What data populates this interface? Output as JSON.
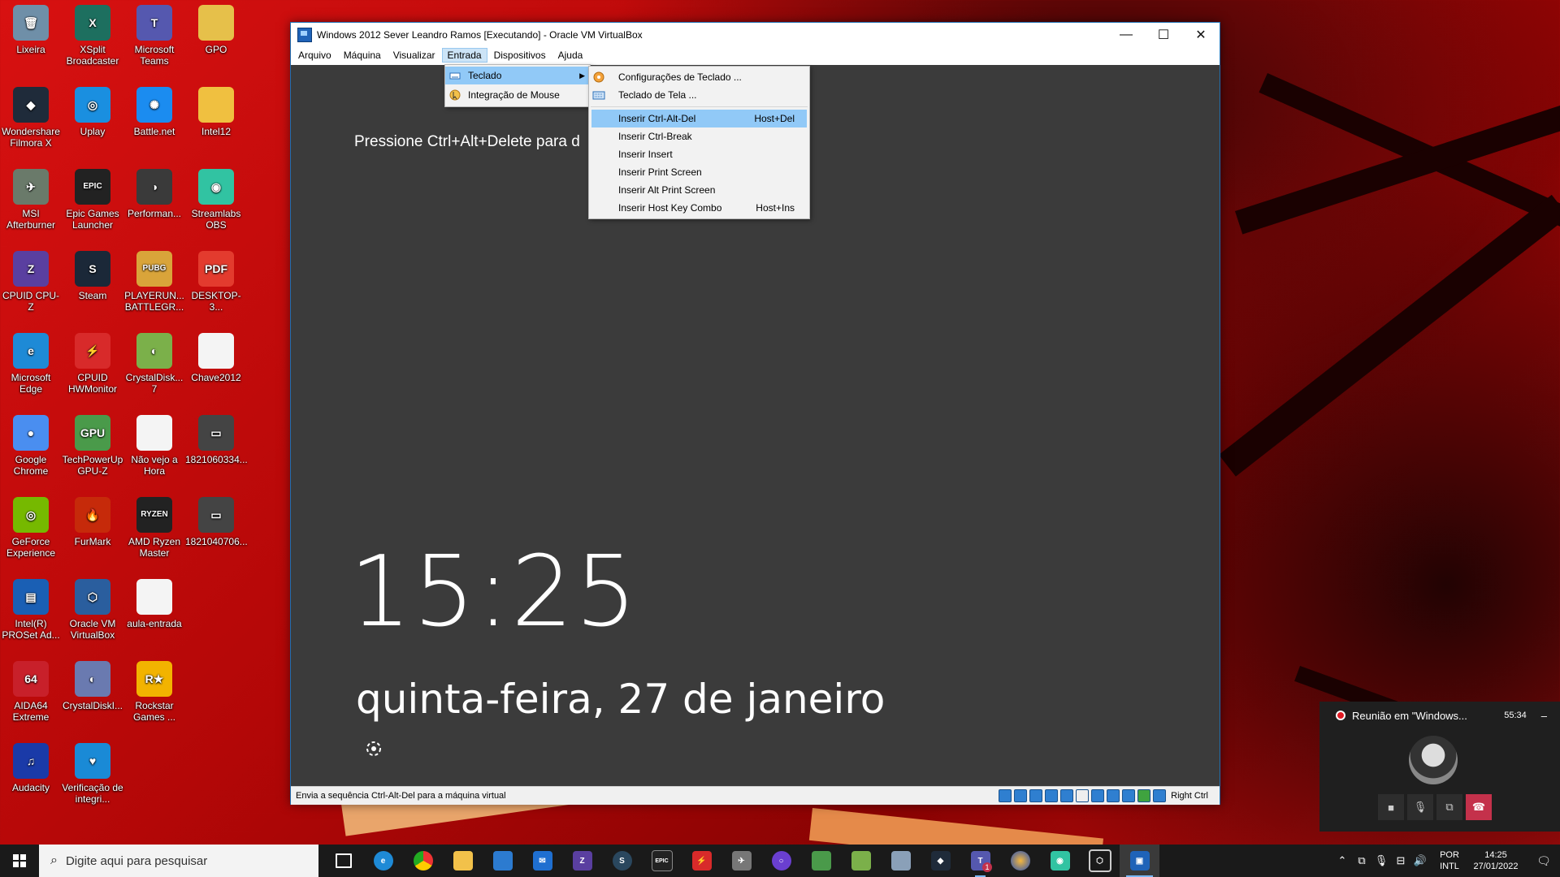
{
  "desktop": {
    "icons": [
      {
        "label": "Lixeira",
        "color": "#6f8fa8",
        "glyph": "🗑"
      },
      {
        "label": "XSplit Broadcaster",
        "color": "#1d6f5f",
        "glyph": "X"
      },
      {
        "label": "Microsoft Teams",
        "color": "#5558af",
        "glyph": "T"
      },
      {
        "label": "GPO",
        "color": "#e6c04a",
        "glyph": ""
      },
      {
        "label": "Wondershare Filmora X",
        "color": "#1f2b3a",
        "glyph": "◆"
      },
      {
        "label": "Uplay",
        "color": "#1a8fe0",
        "glyph": "◎"
      },
      {
        "label": "Battle.net",
        "color": "#1b8cf0",
        "glyph": "✺"
      },
      {
        "label": "Intel12",
        "color": "#f0c040",
        "glyph": ""
      },
      {
        "label": "MSI Afterburner",
        "color": "#6a7a6a",
        "glyph": "✈"
      },
      {
        "label": "Epic Games Launcher",
        "color": "#222222",
        "glyph": "EPIC"
      },
      {
        "label": "Performan...",
        "color": "#3a3a3a",
        "glyph": "◑"
      },
      {
        "label": "Streamlabs OBS",
        "color": "#31c3a2",
        "glyph": "◉"
      },
      {
        "label": "CPUID CPU-Z",
        "color": "#5a3fa0",
        "glyph": "Z"
      },
      {
        "label": "Steam",
        "color": "#1b2838",
        "glyph": "S"
      },
      {
        "label": "PLAYERUN... BATTLEGR...",
        "color": "#d9a43a",
        "glyph": "PUBG"
      },
      {
        "label": "DESKTOP-3...",
        "color": "#e33b2e",
        "glyph": "PDF"
      },
      {
        "label": "Microsoft Edge",
        "color": "#1e8ad6",
        "glyph": "e"
      },
      {
        "label": "CPUID HWMonitor",
        "color": "#d82a2a",
        "glyph": "⚡"
      },
      {
        "label": "CrystalDisk... 7",
        "color": "#7bb04a",
        "glyph": "◐"
      },
      {
        "label": "Chave2012",
        "color": "#f4f4f4",
        "glyph": ""
      },
      {
        "label": "Google Chrome",
        "color": "#4a8ef0",
        "glyph": "●"
      },
      {
        "label": "TechPowerUp GPU-Z",
        "color": "#4a9a4a",
        "glyph": "GPU"
      },
      {
        "label": "Não vejo a Hora",
        "color": "#f4f4f4",
        "glyph": ""
      },
      {
        "label": "1821060334...",
        "color": "#444444",
        "glyph": "▭"
      },
      {
        "label": "GeForce Experience",
        "color": "#76b900",
        "glyph": "◎"
      },
      {
        "label": "FurMark",
        "color": "#c62a0a",
        "glyph": "🔥"
      },
      {
        "label": "AMD Ryzen Master",
        "color": "#222222",
        "glyph": "RYZEN"
      },
      {
        "label": "1821040706...",
        "color": "#444444",
        "glyph": "▭"
      },
      {
        "label": "Intel(R) PROSet Ad...",
        "color": "#1a5fb4",
        "glyph": "▤"
      },
      {
        "label": "Oracle VM VirtualBox",
        "color": "#2a5e9e",
        "glyph": "⬡"
      },
      {
        "label": "aula-entrada",
        "color": "#f4f4f4",
        "glyph": ""
      },
      {
        "label": "",
        "color": "#00000000",
        "glyph": ""
      },
      {
        "label": "AIDA64 Extreme",
        "color": "#c8202a",
        "glyph": "64"
      },
      {
        "label": "CrystalDiskI...",
        "color": "#6a7ab0",
        "glyph": "◐"
      },
      {
        "label": "Rockstar Games ...",
        "color": "#f2b300",
        "glyph": "R★"
      },
      {
        "label": "",
        "color": "#00000000",
        "glyph": ""
      },
      {
        "label": "Audacity",
        "color": "#1a3aa8",
        "glyph": "♫"
      },
      {
        "label": "Verificação de integri...",
        "color": "#1a8ad6",
        "glyph": "♥"
      }
    ]
  },
  "vbox": {
    "title": "Windows 2012 Sever Leandro Ramos [Executando] - Oracle VM VirtualBox",
    "menu": [
      "Arquivo",
      "Máquina",
      "Visualizar",
      "Entrada",
      "Dispositivos",
      "Ajuda"
    ],
    "active_menu_index": 3,
    "lock": {
      "message": "Pressione Ctrl+Alt+Delete para d",
      "time": "15:25",
      "date": "quinta-feira, 27 de janeiro"
    },
    "status_text": "Envia a sequência Ctrl-Alt-Del para a máquina virtual",
    "host_key": "Right Ctrl"
  },
  "entrada_menu": {
    "items": [
      "Teclado",
      "Integração de Mouse"
    ]
  },
  "teclado_menu": {
    "items": [
      {
        "label": "Configurações de Teclado ...",
        "shortcut": ""
      },
      {
        "label": "Teclado de Tela ...",
        "shortcut": ""
      },
      {
        "label": "Inserir Ctrl-Alt-Del",
        "shortcut": "Host+Del"
      },
      {
        "label": "Inserir Ctrl-Break",
        "shortcut": ""
      },
      {
        "label": "Inserir Insert",
        "shortcut": ""
      },
      {
        "label": "Inserir Print Screen",
        "shortcut": ""
      },
      {
        "label": "Inserir Alt Print Screen",
        "shortcut": ""
      },
      {
        "label": "Inserir Host Key Combo",
        "shortcut": "Host+Ins"
      }
    ]
  },
  "teams": {
    "title": "Reunião em \"Windows...",
    "elapsed": "55:34",
    "minimize": "–"
  },
  "taskbar": {
    "search_placeholder": "Digite aqui para pesquisar",
    "lang_line1": "POR",
    "lang_line2": "INTL",
    "time": "14:25",
    "date": "27/01/2022",
    "badge": "1"
  }
}
